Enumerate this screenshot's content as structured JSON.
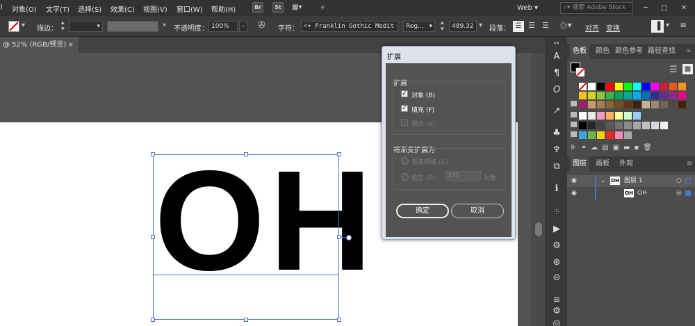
{
  "menu": [
    "对象(O)",
    "文字(T)",
    "选择(S)",
    "效果(C)",
    "视图(V)",
    "窗口(W)",
    "帮助(H)"
  ],
  "menu_lead": ")",
  "app_buttons": {
    "br": "Br",
    "st": "St"
  },
  "workspace": "Web",
  "search_stock": "搜索 Adobe Stock",
  "window_controls": {
    "min": "─",
    "max": "□",
    "close": "✕"
  },
  "control": {
    "stroke_label": "描边：",
    "opacity_label": "不透明度：",
    "opacity_value": "100%",
    "char_label": "字符：",
    "font_name": "Franklin Gothic Medit",
    "font_style": "Reg...",
    "font_size": "489.32",
    "para_label": "段落：",
    "align_label": "对齐",
    "transform_label": "变换"
  },
  "doc_tab": {
    "title": "@ 52% (RGB/预览)",
    "close": "×"
  },
  "artwork_text": "OH",
  "dialog": {
    "title": "扩展",
    "expand_group": "扩展",
    "object_label": "对象 (B)",
    "fill_label": "填充 (F)",
    "stroke_label": "描边 (S)",
    "gradient_group": "将渐变扩展为",
    "mesh_label": "渐变网格 (G)",
    "specify_label": "指定 (E):",
    "specify_value": "255",
    "object_unit": "对象",
    "ok": "确定",
    "cancel": "取消",
    "object_checked": true,
    "fill_checked": true,
    "stroke_checked": false
  },
  "tools": [
    "A",
    "¶",
    "O",
    "↗",
    "♣",
    "♆",
    "⧉",
    "ℹ",
    "⁘",
    "▶",
    "⚙",
    "⊛",
    "⊝",
    "≡",
    "⚙",
    "◎"
  ],
  "swatches_tabs": [
    "色板",
    "颜色",
    "颜色参考",
    "路径查找"
  ],
  "swatches": {
    "row1": [
      "#ffffff",
      "#ffffff",
      "#000000",
      "#ff0000",
      "#ffff00",
      "#00ff00",
      "#00ffff",
      "#0000ff",
      "#ff00ff",
      "#cc2233",
      "#e55a1c",
      "#f7941d"
    ],
    "row2": [
      "#f9c21b",
      "#d4d41e",
      "#8dc63f",
      "#39b54a",
      "#00a651",
      "#00a99d",
      "#00aeef",
      "#0072bc",
      "#2e3192",
      "#662d91",
      "#92278f",
      "#ec008c"
    ],
    "row3": [
      "#9e1f63",
      "#c69c6d",
      "#a67c52",
      "#8c6239",
      "#754c24",
      "#603913",
      "#3c2415",
      "#c7b299",
      "#998675",
      "#736357",
      "#534741",
      "#42210b"
    ],
    "row4": [
      "#ffffff",
      "#e8e8e8",
      "#f49ac2",
      "#fbaf5d",
      "#ffff99",
      "#ccffcc",
      "#99ccff"
    ],
    "row5": [
      "#000000",
      "#262626",
      "#404040",
      "#595959",
      "#737373",
      "#8c8c8c",
      "#a6a6a6",
      "#bfbfbf",
      "#d9d9d9",
      "#f2f2f2"
    ],
    "row6": [
      "#3ca6de",
      "#67b845",
      "#f7d117",
      "#ee2a27",
      "#f48ab3",
      "#a6a6a6"
    ]
  },
  "layers_tabs": [
    "图层",
    "画板",
    "外观"
  ],
  "layers": [
    {
      "name": "图层 1",
      "thumb": "OH"
    },
    {
      "name": "OH",
      "thumb": "OH"
    }
  ]
}
